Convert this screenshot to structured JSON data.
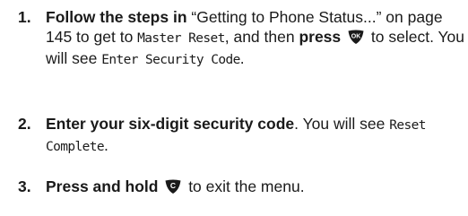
{
  "steps": [
    {
      "number": "1.",
      "lead_bold": "Follow the steps in",
      "ref_text": " “Getting to Phone Status...” on page 145 to get to ",
      "lcd_target": "Master Reset",
      "connector": ", and then ",
      "action_bold": "press",
      "key_icon": "ok-key-icon",
      "key_glyph": "OK",
      "after_key": " to select. You will see ",
      "lcd_result": "Enter Security Code",
      "end": "."
    },
    {
      "number": "2.",
      "lead_bold": "Enter your six-digit security code",
      "after_lead": ". You will see ",
      "lcd_result": "Reset Complete",
      "end": "."
    },
    {
      "number": "3.",
      "lead_bold": "Press and hold",
      "key_icon": "clear-key-icon",
      "key_glyph": "C",
      "after_key": " to exit the menu."
    }
  ]
}
